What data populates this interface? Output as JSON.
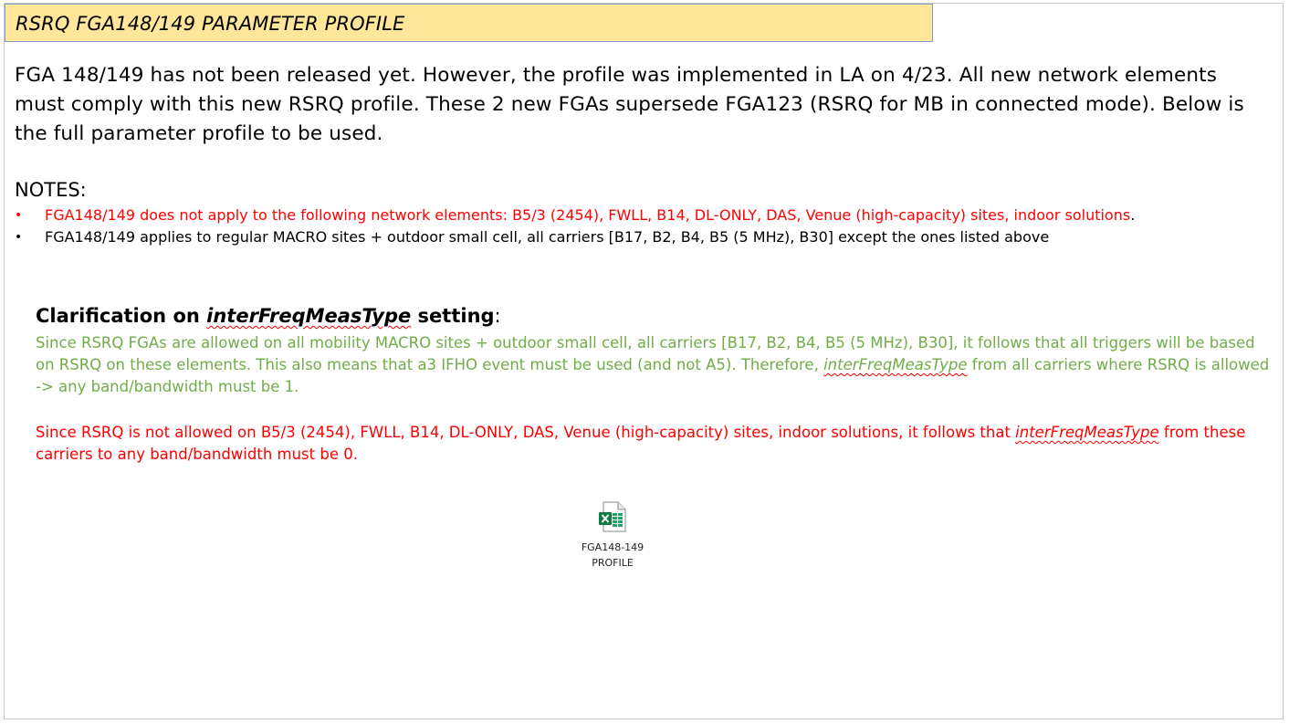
{
  "title": "RSRQ FGA148/149 PARAMETER PROFILE",
  "intro": "FGA 148/149 has not been released yet. However, the profile was implemented in LA on 4/23. All new network elements must comply with this new RSRQ profile. These 2 new FGAs supersede FGA123 (RSRQ for MB in connected mode). Below is the full parameter profile to be used.",
  "notes": {
    "heading": "NOTES:",
    "bullet_char": "•",
    "items": [
      {
        "text": "FGA148/149 does not apply to the following network elements: B5/3 (2454), FWLL, B14, DL-ONLY, DAS, Venue (high-capacity) sites, indoor solutions",
        "trailing": ".",
        "color": "#ff0000"
      },
      {
        "text": "FGA148/149 applies to regular MACRO sites + outdoor small cell, all carriers [B17, B2, B4, B5 (5 MHz), B30] except the ones listed above",
        "color": "#000000"
      }
    ]
  },
  "clarification": {
    "heading_prefix": "Clarification on ",
    "heading_term": "interFreqMeasType",
    "heading_suffix": " setting",
    "heading_colon": ":",
    "green_para": {
      "part1": "Since RSRQ FGAs are allowed on all mobility MACRO sites + outdoor small cell, all carriers [B17, B2, B4, B5 (5 MHz), B30], it follows that all triggers will be based on RSRQ on these elements. This also means that a3 IFHO event must be used (and not A5). Therefore, ",
      "term": "interFreqMeasType",
      "part2": " from all carriers where RSRQ is allowed -> any band/bandwidth must be 1.",
      "color": "#70ad47"
    },
    "red_para": {
      "part1": "Since RSRQ is not allowed on B5/3 (2454), FWLL, B14, DL-ONLY, DAS, Venue (high-capacity) sites, indoor solutions, it follows that ",
      "term": "interFreqMeasType",
      "part2": " from these carriers to any band/bandwidth must be 0.",
      "color": "#ff0000"
    }
  },
  "embedded_file": {
    "icon": "excel-file-icon",
    "caption_line1": "FGA148-149",
    "caption_line2": "PROFILE"
  },
  "colors": {
    "title_bg": "#ffe699",
    "title_border": "#7f9fd0",
    "green": "#70ad47",
    "red": "#ff0000"
  }
}
